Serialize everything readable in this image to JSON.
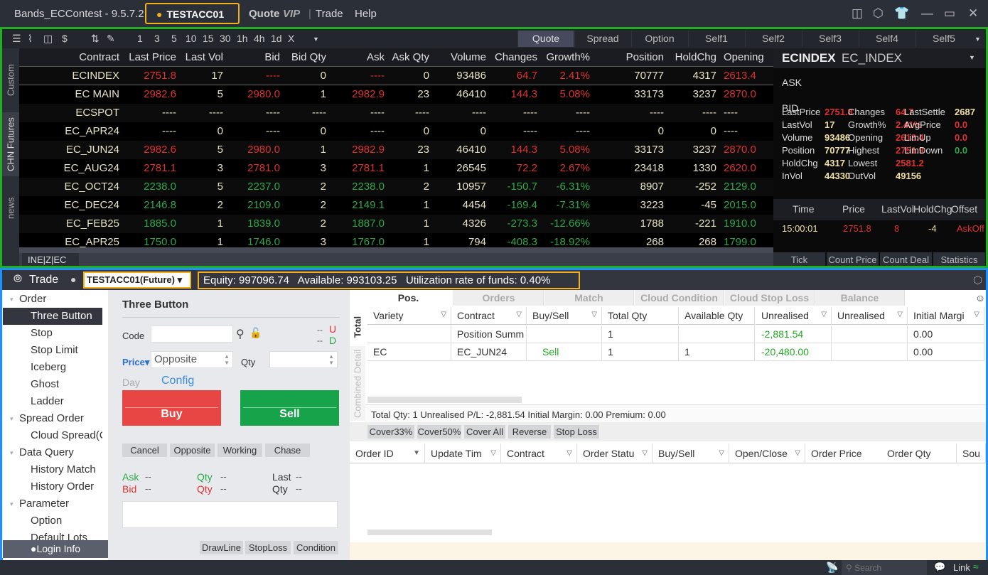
{
  "title": "Bands_ECContest - 9.5.7.2",
  "account": "TESTACC01",
  "menu": {
    "quote": "Quote",
    "vip": "VIP",
    "trade": "Trade",
    "help": "Help"
  },
  "toolbar": {
    "intervals": [
      "1",
      "3",
      "5",
      "10",
      "15",
      "30",
      "1h",
      "4h",
      "1d",
      "X"
    ]
  },
  "quote_tabs": [
    {
      "label": "Quote",
      "active": true
    },
    {
      "label": "Spread"
    },
    {
      "label": "Option"
    },
    {
      "label": "Self1"
    },
    {
      "label": "Self2"
    },
    {
      "label": "Self3"
    },
    {
      "label": "Self4"
    },
    {
      "label": "Self5"
    }
  ],
  "side_tabs": [
    "Custom",
    "CHN Futures",
    "news"
  ],
  "exchange_tab": "INE|Z|EC",
  "quote_table": {
    "columns": [
      "Contract",
      "Last Price",
      "Last Vol",
      "Bid",
      "Bid Qty",
      "Ask",
      "Ask Qty",
      "Volume",
      "Changes",
      "Growth%",
      "Position",
      "HoldChg",
      "Opening"
    ],
    "rows": [
      {
        "dir": "up",
        "cells": [
          "ECINDEX",
          "2751.8",
          "17",
          "----",
          "0",
          "----",
          "0",
          "93486",
          "64.7",
          "2.41%",
          "70777",
          "4317",
          "2613.4"
        ]
      },
      {
        "dir": "up",
        "cells": [
          "EC MAIN",
          "2982.6",
          "5",
          "2980.0",
          "1",
          "2982.9",
          "23",
          "46410",
          "144.3",
          "5.08%",
          "33173",
          "3237",
          "2870.0"
        ]
      },
      {
        "dir": "none",
        "cells": [
          "ECSPOT",
          "----",
          "----",
          "----",
          "----",
          "----",
          "----",
          "----",
          "----",
          "----",
          "----",
          "----",
          "----"
        ]
      },
      {
        "dir": "none",
        "cells": [
          "EC_APR24",
          "----",
          "0",
          "----",
          "0",
          "----",
          "0",
          "0",
          "----",
          "----",
          "0",
          "0",
          "----"
        ]
      },
      {
        "dir": "up",
        "cells": [
          "EC_JUN24",
          "2982.6",
          "5",
          "2980.0",
          "1",
          "2982.9",
          "23",
          "46410",
          "144.3",
          "5.08%",
          "33173",
          "3237",
          "2870.0"
        ]
      },
      {
        "dir": "up",
        "cells": [
          "EC_AUG24",
          "2781.1",
          "3",
          "2781.0",
          "3",
          "2781.1",
          "1",
          "26545",
          "72.2",
          "2.67%",
          "23418",
          "1330",
          "2620.0"
        ]
      },
      {
        "dir": "down",
        "cells": [
          "EC_OCT24",
          "2238.0",
          "5",
          "2237.0",
          "2",
          "2238.0",
          "2",
          "10957",
          "-150.7",
          "-6.31%",
          "8907",
          "-252",
          "2129.0"
        ]
      },
      {
        "dir": "down",
        "cells": [
          "EC_DEC24",
          "2146.8",
          "2",
          "2109.0",
          "2",
          "2149.1",
          "1",
          "4454",
          "-169.4",
          "-7.31%",
          "3223",
          "-45",
          "2015.0"
        ]
      },
      {
        "dir": "down",
        "cells": [
          "EC_FEB25",
          "1885.0",
          "1",
          "1839.0",
          "2",
          "1887.0",
          "1",
          "4326",
          "-273.3",
          "-12.66%",
          "1788",
          "-221",
          "1910.0"
        ]
      },
      {
        "dir": "down",
        "cells": [
          "EC_APR25",
          "1750.0",
          "1",
          "1746.0",
          "3",
          "1767.0",
          "1",
          "794",
          "-408.3",
          "-18.92%",
          "268",
          "268",
          "1799.0"
        ]
      }
    ]
  },
  "detail": {
    "symbol": "ECINDEX",
    "name": "EC_INDEX",
    "ask": "ASK",
    "bid": "BID",
    "fields": [
      [
        {
          "k": "LastPrice",
          "v": "2751.8",
          "c": "r"
        },
        {
          "k": "Changes",
          "v": "64.7",
          "c": "r"
        },
        {
          "k": "LastSettle",
          "v": "2687",
          "c": "y"
        }
      ],
      [
        {
          "k": "LastVol",
          "v": "17",
          "c": "y"
        },
        {
          "k": "Growth%",
          "v": "2.41%",
          "c": "r"
        },
        {
          "k": "AvgPrice",
          "v": "0.0",
          "c": "r"
        }
      ],
      [
        {
          "k": "Volume",
          "v": "93486",
          "c": "y"
        },
        {
          "k": "Opening",
          "v": "2613.4",
          "c": "r"
        },
        {
          "k": "LimUp",
          "v": "0.0",
          "c": "r"
        }
      ],
      [
        {
          "k": "Position",
          "v": "70777",
          "c": "y"
        },
        {
          "k": "Highest",
          "v": "2751.9",
          "c": "r"
        },
        {
          "k": "LimDown",
          "v": "0.0",
          "c": "g"
        }
      ],
      [
        {
          "k": "HoldChg",
          "v": "4317",
          "c": "y"
        },
        {
          "k": "Lowest",
          "v": "2581.2",
          "c": "r"
        }
      ],
      [
        {
          "k": "InVol",
          "v": "44330",
          "c": "y"
        },
        {
          "k": "OutVol",
          "v": "49156",
          "c": "y"
        }
      ]
    ],
    "tick_headers": [
      "Time",
      "Price",
      "LastVol",
      "HoldChg",
      "Offset"
    ],
    "ticks": [
      {
        "time": "15:00:01",
        "price": "2751.8",
        "lastvol": "8",
        "holdchg": "-4",
        "offset": "AskOff"
      }
    ],
    "tabs": [
      "Tick",
      "Count Price",
      "Count Deal",
      "Statistics"
    ]
  },
  "trade": {
    "title": "Trade",
    "account_select": "TESTACC01(Future)",
    "funds": "Equity: 997096.74   Available: 993103.25   Utilization rate of funds: 0.40%",
    "nav": [
      {
        "label": "Order",
        "type": "grp"
      },
      {
        "label": "Three Button",
        "type": "sub",
        "active": true
      },
      {
        "label": "Stop",
        "type": "sub"
      },
      {
        "label": "Stop Limit",
        "type": "sub"
      },
      {
        "label": "Iceberg",
        "type": "sub"
      },
      {
        "label": "Ghost",
        "type": "sub"
      },
      {
        "label": "Ladder",
        "type": "sub"
      },
      {
        "label": "Spread Order",
        "type": "grp"
      },
      {
        "label": "Cloud Spread(Cloud)",
        "type": "sub"
      },
      {
        "label": "Data Query",
        "type": "grp"
      },
      {
        "label": "History Match",
        "type": "sub"
      },
      {
        "label": "History Order",
        "type": "sub"
      },
      {
        "label": "Parameter",
        "type": "grp"
      },
      {
        "label": "Option",
        "type": "sub"
      },
      {
        "label": "Default Lots",
        "type": "sub"
      }
    ],
    "login_info": "Login Info",
    "form": {
      "title": "Three Button",
      "code_label": "Code",
      "code_value": "",
      "u": "U",
      "d": "D",
      "dashes": "--",
      "price_label": "Price",
      "price_value": "Opposite",
      "qty_label": "Qty",
      "qty_value": "",
      "day": "Day",
      "config": "Config",
      "buy": "Buy",
      "sell": "Sell",
      "actions": [
        "Cancel",
        "Opposite",
        "Working",
        "Chase"
      ],
      "ask": "Ask",
      "bid": "Bid",
      "qty": "Qty",
      "last": "Last",
      "empty": "--",
      "bottom": [
        "DrawLine",
        "StopLoss",
        "Condition"
      ]
    },
    "tabs": [
      {
        "label": "Pos.",
        "active": true
      },
      {
        "label": "Orders"
      },
      {
        "label": "Match"
      },
      {
        "label": "Cloud Condition"
      },
      {
        "label": "Cloud Stop Loss"
      },
      {
        "label": "Balance"
      }
    ],
    "pos_side_tabs": [
      "Total",
      "Combined Detail"
    ],
    "pos_columns": [
      "Variety",
      "Contract",
      "Buy/Sell",
      "Total Qty",
      "Available Qty",
      "Unrealised",
      "Unrealised",
      "Initial Margi"
    ],
    "pos_rows": [
      [
        "",
        "Position Summ",
        "",
        "1",
        "",
        "-2,881.54",
        "",
        "0.00"
      ],
      [
        "EC",
        "EC_JUN24",
        "Sell",
        "1",
        "1",
        "-20,480.00",
        "",
        "0.00"
      ]
    ],
    "summary": "Total Qty: 1  Unrealised P/L: -2,881.54  Initial Margin: 0.00  Premium: 0.00",
    "pos_actions": [
      "Cover33%",
      "Cover50%",
      "Cover All",
      "Reverse",
      "Stop Loss"
    ],
    "order_columns": [
      "Order ID",
      "Update Tim",
      "Contract",
      "Order Statu",
      "Buy/Sell",
      "Open/Close",
      "Order Price",
      "Order Qty",
      "Sou"
    ]
  },
  "status": {
    "search_placeholder": "Search",
    "link": "Link"
  }
}
